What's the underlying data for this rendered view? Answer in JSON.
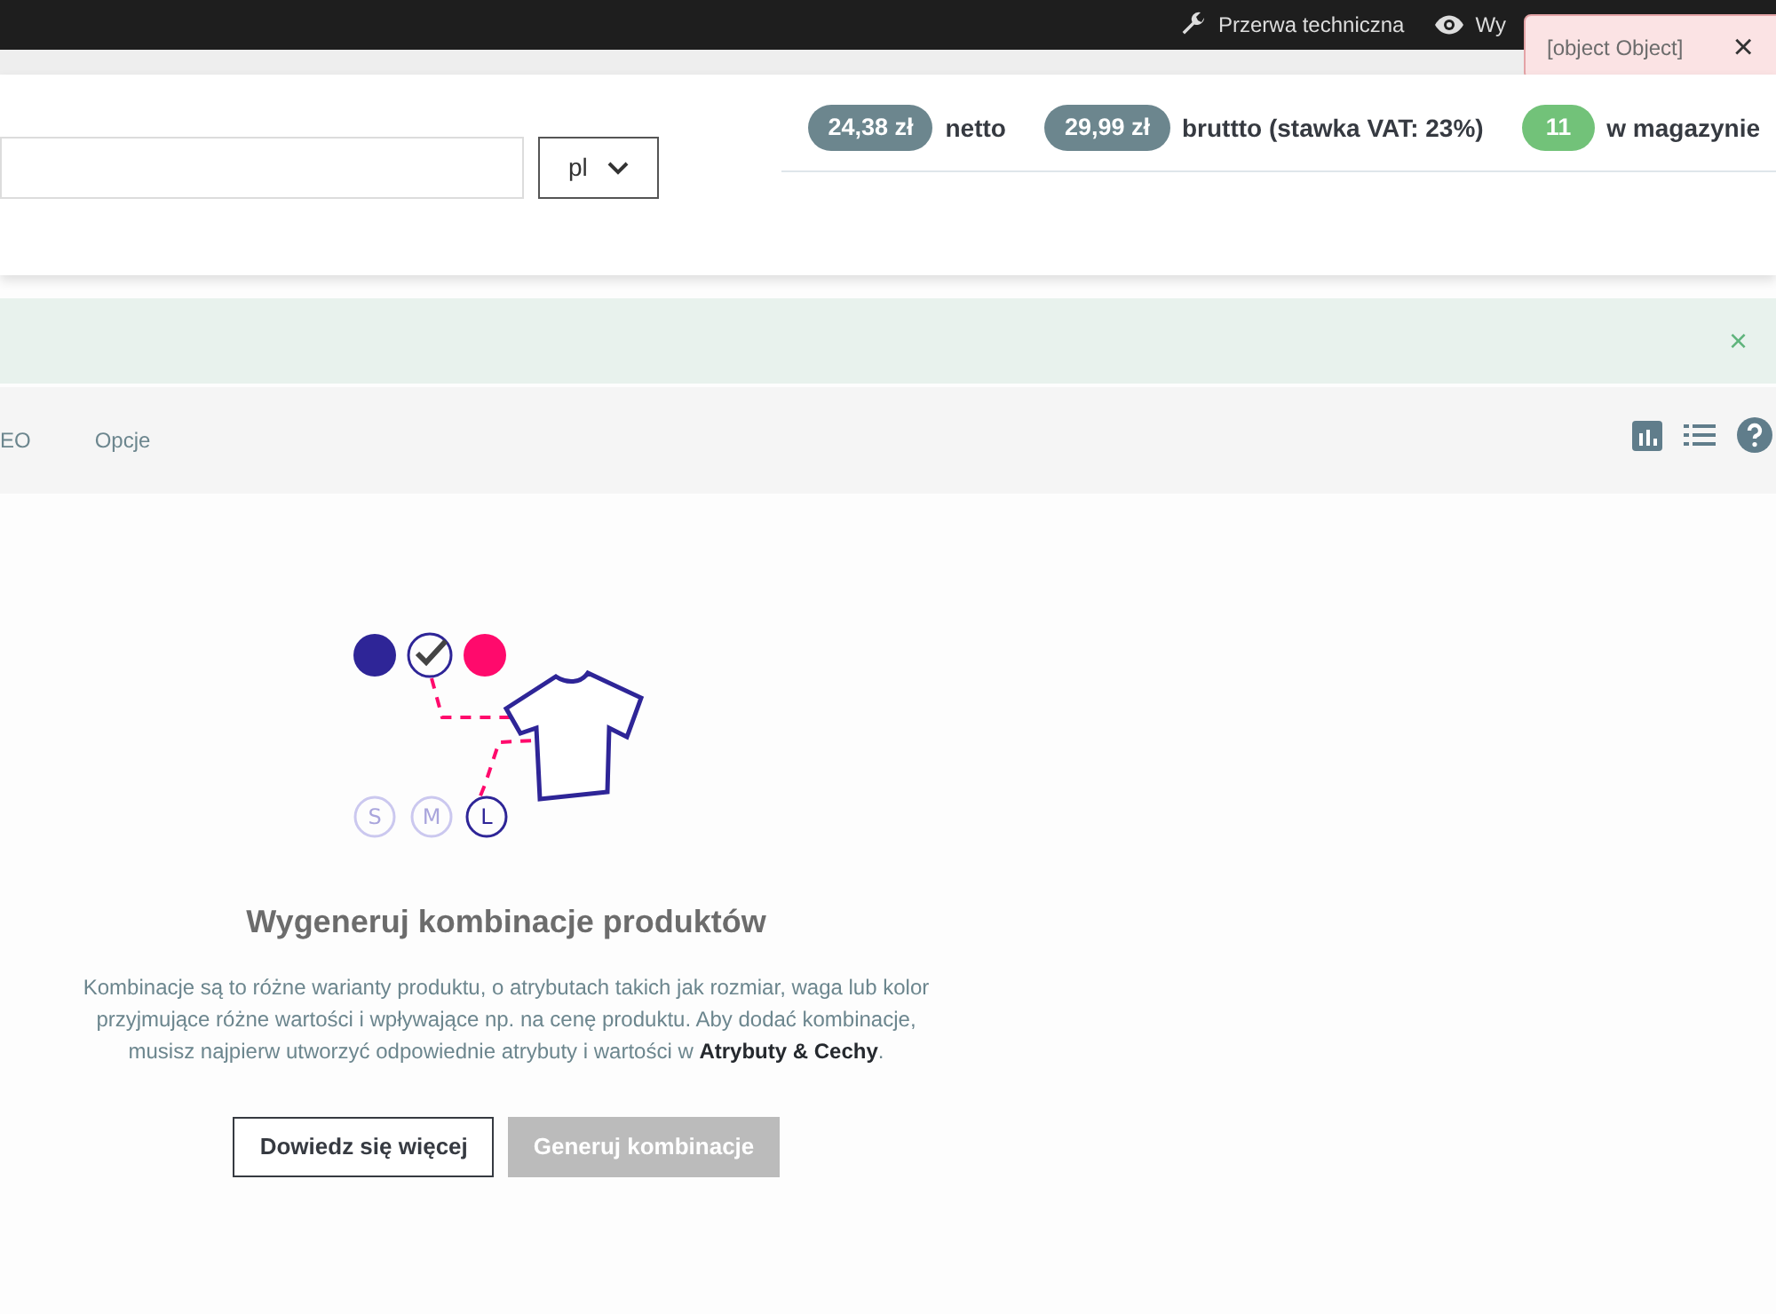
{
  "top_bar": {
    "items": [
      {
        "kind": "wrench",
        "label": "Przerwa techniczna"
      },
      {
        "kind": "eye",
        "label": "Wy"
      }
    ]
  },
  "toast": {
    "message": "[object Object]",
    "close": "×"
  },
  "header": {
    "language": "pl",
    "prices": [
      {
        "value": "24,38 zł",
        "label": "netto",
        "kind": "price"
      },
      {
        "value": "29,99 zł",
        "label": "bruttto (stawka VAT: 23%)",
        "kind": "price"
      },
      {
        "value": "11",
        "label": "w magazynie",
        "kind": "stock"
      }
    ]
  },
  "alert": {
    "close": "×"
  },
  "tabs": [
    {
      "label": "EO",
      "selected": false
    },
    {
      "label": "Opcje",
      "selected": false
    }
  ],
  "empty_state": {
    "title": "Wygeneruj kombinacje produktów",
    "text": "Kombinacje są to różne warianty produktu, o atrybutach takich jak rozmiar, waga lub kolor przyjmujące różne wartości i wpływające np. na cenę produktu. Aby dodać kombinacje, musisz najpierw utworzyć odpowiednie atrybuty i wartości w **Atrybuty & Cechy**.",
    "sizes": [
      "S",
      "M",
      "L"
    ],
    "buttons": [
      {
        "label": "Dowiedz się więcej",
        "disabled": false
      },
      {
        "label": "Generuj kombinacje",
        "disabled": true
      }
    ]
  }
}
